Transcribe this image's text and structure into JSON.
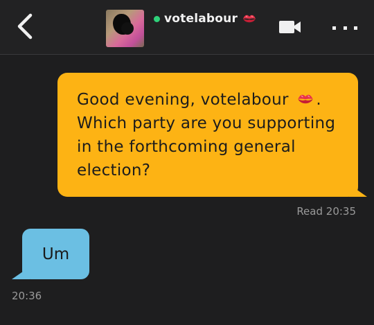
{
  "header": {
    "back_icon": "chevron-left-icon",
    "contact_name": "votelabour",
    "status_color": "#2fd27a",
    "name_emoji": "kiss-mark-emoji",
    "video_icon": "video-camera-icon",
    "more_icon": "more-dots-icon"
  },
  "messages": [
    {
      "direction": "outgoing",
      "line1_prefix": "Good evening, votelabour",
      "line1_suffix": ".",
      "line2": "Which party are you supporting",
      "line3": "in the forthcoming general",
      "line4": "election?",
      "receipt": "Read 20:35",
      "color": "#fdb314"
    },
    {
      "direction": "incoming",
      "text": "Um",
      "time": "20:36",
      "color": "#6bbfe3"
    }
  ]
}
